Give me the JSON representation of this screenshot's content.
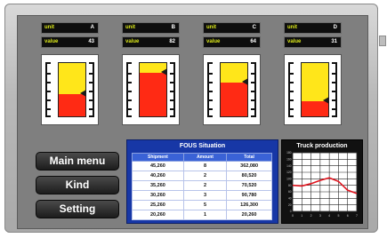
{
  "gauges": [
    {
      "unit_label": "unit",
      "unit": "A",
      "value_label": "value",
      "value": "43",
      "level": 0.43
    },
    {
      "unit_label": "unit",
      "unit": "B",
      "value_label": "value",
      "value": "82",
      "level": 0.82
    },
    {
      "unit_label": "unit",
      "unit": "C",
      "value_label": "value",
      "value": "64",
      "level": 0.64
    },
    {
      "unit_label": "unit",
      "unit": "D",
      "value_label": "value",
      "value": "31",
      "level": 0.31
    }
  ],
  "menu": {
    "main_menu": "Main menu",
    "kind": "Kind",
    "setting": "Setting"
  },
  "table": {
    "title": "FOUS Situation",
    "columns": [
      "Shipment",
      "Amount",
      "Total"
    ],
    "rows": [
      [
        "45,260",
        "8",
        "362,080"
      ],
      [
        "40,260",
        "2",
        "80,520"
      ],
      [
        "35,260",
        "2",
        "70,520"
      ],
      [
        "30,260",
        "3",
        "90,780"
      ],
      [
        "25,260",
        "5",
        "126,300"
      ],
      [
        "20,260",
        "1",
        "20,260"
      ]
    ]
  },
  "chart_data": {
    "type": "line",
    "title": "Truck production",
    "x": [
      0,
      1,
      2,
      3,
      4,
      5,
      6,
      7
    ],
    "series": [
      {
        "values": [
          80,
          78,
          85,
          95,
          103,
          92,
          65,
          55
        ]
      }
    ],
    "xlim": [
      0,
      7
    ],
    "ylim": [
      0,
      180
    ],
    "y_ticks": [
      0,
      20,
      40,
      60,
      80,
      100,
      120,
      140,
      160,
      180
    ],
    "x_ticks": [
      0,
      1,
      2,
      3,
      4,
      5,
      6,
      7
    ],
    "grid": true,
    "colors": {
      "plot_bg": "#ffffff",
      "line": "#e0141e",
      "frame": "#111111"
    }
  },
  "colors": {
    "gauge_red": "#ff2a14",
    "gauge_yellow": "#ffe61a",
    "label_yellow": "#dbe81a",
    "panel_gray": "#7f7f7f",
    "table_blue": "#1737a6"
  }
}
